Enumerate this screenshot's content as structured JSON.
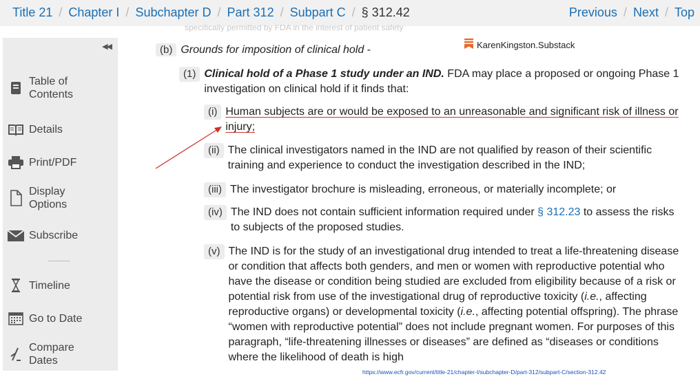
{
  "breadcrumb": {
    "items": [
      "Title 21",
      "Chapter I",
      "Subchapter D",
      "Part 312",
      "Subpart C"
    ],
    "separator": "/",
    "current": "§ 312.42"
  },
  "nav": {
    "previous": "Previous",
    "next": "Next",
    "top": "Top",
    "separator": "/"
  },
  "ghost_text": "specifically permitted by FDA in the interest of patient safety",
  "sidebar": {
    "collapse_glyph": "◀◀",
    "items": [
      {
        "label": "Table of Contents",
        "icon": "book-icon"
      },
      {
        "label": "Details",
        "icon": "open-book-icon"
      },
      {
        "label": "Print/PDF",
        "icon": "printer-icon"
      },
      {
        "label": "Display Options",
        "icon": "document-icon"
      },
      {
        "label": "Subscribe",
        "icon": "envelope-icon"
      },
      {
        "label": "Timeline",
        "icon": "hourglass-icon"
      },
      {
        "label": "Go to Date",
        "icon": "calendar-icon"
      },
      {
        "label": "Compare Dates",
        "icon": "compare-icon"
      }
    ]
  },
  "content": {
    "b": {
      "label": "(b)",
      "title": "Grounds for imposition of clinical hold",
      "suffix": " -"
    },
    "p1": {
      "label": "(1)",
      "title": "Clinical hold of a Phase 1 study under an IND.",
      "text": " FDA may place a proposed or ongoing Phase 1 investigation on clinical hold if it finds that:"
    },
    "items": [
      {
        "label": "(i)",
        "text": "Human subjects are or would be exposed to an unreasonable and significant risk of illness or injury;"
      },
      {
        "label": "(ii)",
        "text": "The clinical investigators named in the IND are not qualified by reason of their scientific training and experience to conduct the investigation described in the IND;"
      },
      {
        "label": "(iii)",
        "text": "The investigator brochure is misleading, erroneous, or materially incomplete; or"
      },
      {
        "label": "(iv)",
        "text_before": "The IND does not contain sufficient information required under ",
        "link": "§ 312.23",
        "text_after": " to assess the risks to subjects of the proposed studies."
      },
      {
        "label": "(v)",
        "t1": "The IND is for the study of an investigational drug intended to treat a life-threatening disease or condition that affects both genders, and men or women with reproductive potential who have the disease or condition being studied are excluded from eligibility because of a risk or potential risk from use of the investigational drug of reproductive toxicity (",
        "ie1": "i.e.",
        "t2": ", affecting reproductive organs) or developmental toxicity (",
        "ie2": "i.e.",
        "t3": ", affecting potential offspring). The phrase “women with reproductive potential” does not include pregnant women. For purposes of this paragraph, “life-threatening illnesses or diseases” are defined as “diseases or conditions where the likelihood of death is high"
      }
    ]
  },
  "watermark": {
    "text": "KarenKingston.Substack",
    "color": "#e8692c"
  },
  "source_url": "https://www.ecfr.gov/current/title-21/chapter-I/subchapter-D/part-312/subpart-C/section-312.42",
  "colors": {
    "link": "#1a6fb5",
    "annotation": "#d0302a",
    "sidebar_bg": "#ececec",
    "topbar_bg": "#f1f1f1"
  }
}
